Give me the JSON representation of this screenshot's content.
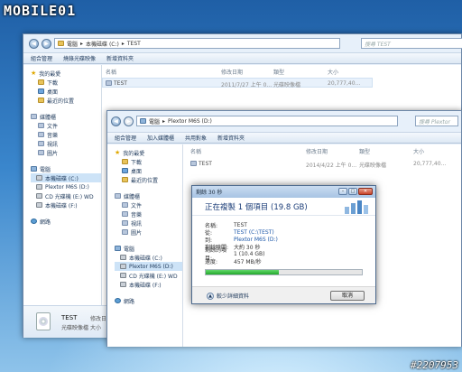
{
  "logo": "MOBILE01",
  "watermark": "#2207953",
  "back_window": {
    "path": [
      "電腦",
      "本機磁碟 (C:)",
      "TEST"
    ],
    "search_placeholder": "搜尋 TEST",
    "toolbar": [
      "組合管理",
      "燒錄光碟映像",
      "新增資料夾"
    ],
    "nav": [
      {
        "label": "我的最愛",
        "icon": "star-icon"
      },
      {
        "label": "下載",
        "icon": "download-folder-icon"
      },
      {
        "label": "桌面",
        "icon": "desktop-icon"
      },
      {
        "label": "最近的位置",
        "icon": "recent-icon"
      },
      {
        "label": "媒體櫃",
        "icon": "library-icon"
      },
      {
        "label": "文件",
        "icon": "documents-icon"
      },
      {
        "label": "音樂",
        "icon": "music-icon"
      },
      {
        "label": "視訊",
        "icon": "video-icon"
      },
      {
        "label": "圖片",
        "icon": "pictures-icon"
      },
      {
        "label": "電腦",
        "icon": "computer-icon"
      },
      {
        "label": "本機磁碟 (C:)",
        "icon": "drive-icon"
      },
      {
        "label": "Plextor M6S (D:)",
        "icon": "drive-icon"
      },
      {
        "label": "CD 光碟機 (E:) WD",
        "icon": "cd-drive-icon"
      },
      {
        "label": "本機磁碟 (F:)",
        "icon": "drive-icon"
      },
      {
        "label": "網路",
        "icon": "network-icon"
      }
    ],
    "columns": [
      "名稱",
      "修改日期",
      "類型",
      "大小"
    ],
    "file": {
      "name": "TEST",
      "date": "2011/7/27 上午 0...",
      "type": "光碟映像檔",
      "size": "20,777,40..."
    },
    "details": {
      "name": "TEST",
      "mod_label": "修改日",
      "type": "光碟映像檔",
      "size_label": "大小"
    }
  },
  "front_window": {
    "path": [
      "電腦",
      "Plextor M6S (D:)"
    ],
    "search_placeholder": "搜尋 Plextor",
    "toolbar": [
      "組合管理",
      "加入媒體櫃",
      "共用對象",
      "新增資料夾"
    ],
    "nav": [
      {
        "label": "我的最愛",
        "icon": "star-icon"
      },
      {
        "label": "下載",
        "icon": "download-folder-icon"
      },
      {
        "label": "桌面",
        "icon": "desktop-icon"
      },
      {
        "label": "最近的位置",
        "icon": "recent-icon"
      },
      {
        "label": "媒體櫃",
        "icon": "library-icon"
      },
      {
        "label": "文件",
        "icon": "documents-icon"
      },
      {
        "label": "音樂",
        "icon": "music-icon"
      },
      {
        "label": "視訊",
        "icon": "video-icon"
      },
      {
        "label": "圖片",
        "icon": "pictures-icon"
      },
      {
        "label": "電腦",
        "icon": "computer-icon"
      },
      {
        "label": "本機磁碟 (C:)",
        "icon": "drive-icon"
      },
      {
        "label": "Plextor M6S (D:)",
        "icon": "drive-icon"
      },
      {
        "label": "CD 光碟機 (E:) WD",
        "icon": "cd-drive-icon"
      },
      {
        "label": "本機磁碟 (F:)",
        "icon": "drive-icon"
      },
      {
        "label": "網路",
        "icon": "network-icon"
      }
    ],
    "columns": [
      "名稱",
      "修改日期",
      "類型",
      "大小"
    ],
    "file": {
      "name": "TEST",
      "date": "2014/4/22 上午 0...",
      "type": "光碟映像檔",
      "size": "20,777,40..."
    }
  },
  "copy_dialog": {
    "title": "剩餘 30 秒",
    "heading": "正在複製 1 個項目 (19.8 GB)",
    "rows": [
      {
        "k": "名稱:",
        "v": "TEST"
      },
      {
        "k": "從:",
        "v": "TEST (C:\\TEST)"
      },
      {
        "k": "到:",
        "v": "Plextor M6S (D:)"
      },
      {
        "k": "剩餘時間:",
        "v": "大約 30 秒"
      },
      {
        "k": "剩餘的項目:",
        "v": "1 (10.4 GB)"
      },
      {
        "k": "速度:",
        "v": "457 MB/秒"
      }
    ],
    "progress": 0.47,
    "less_details": "較少詳細資料",
    "cancel": "取消"
  }
}
